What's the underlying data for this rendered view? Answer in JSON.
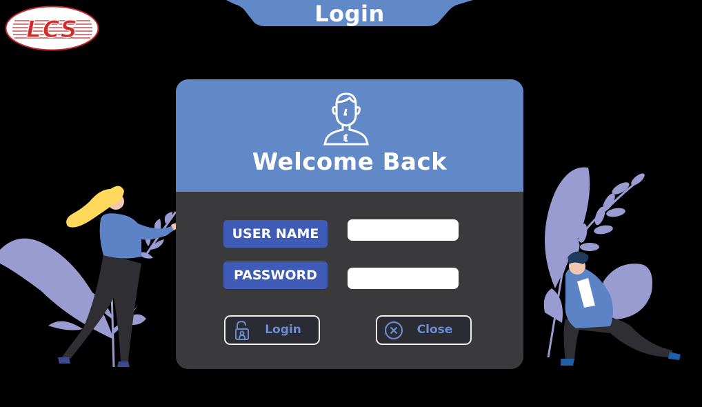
{
  "logo": {
    "text": "LCS"
  },
  "header": {
    "title": "Login"
  },
  "card": {
    "welcome": "Welcome Back",
    "username_label": "USER NAME",
    "password_label": "PASSWORD",
    "username_value": "",
    "password_value": "",
    "login_label": "Login",
    "close_label": "Close"
  },
  "colors": {
    "header_blue": "#6289c7",
    "badge_blue": "#3e5bb5",
    "card_body": "#3a393b",
    "button_text": "#6d8cd0",
    "logo_red": "#d32a2a"
  },
  "icons": [
    "lcs-logo",
    "user-avatar-icon",
    "padlock-icon",
    "close-circle-icon"
  ]
}
